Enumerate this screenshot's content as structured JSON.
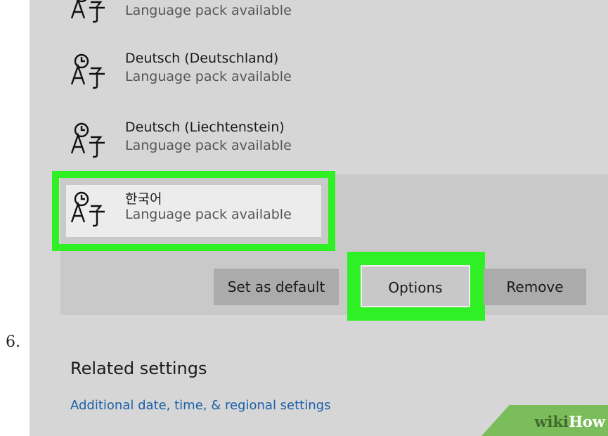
{
  "step": {
    "number": "6."
  },
  "languages": [
    {
      "name": "",
      "status": "Language pack available"
    },
    {
      "name": "Deutsch (Deutschland)",
      "status": "Language pack available"
    },
    {
      "name": "Deutsch (Liechtenstein)",
      "status": "Language pack available"
    },
    {
      "name": "한국어",
      "status": "Language pack available"
    }
  ],
  "actions": {
    "set_default": "Set as default",
    "options": "Options",
    "remove": "Remove"
  },
  "related": {
    "heading": "Related settings",
    "link": "Additional date, time, & regional settings"
  },
  "watermark": {
    "part1": "wiki",
    "part2": "How"
  },
  "colors": {
    "highlight": "#2ff024",
    "panel_bg": "#d6d6d6",
    "link": "#1b5fa8"
  }
}
